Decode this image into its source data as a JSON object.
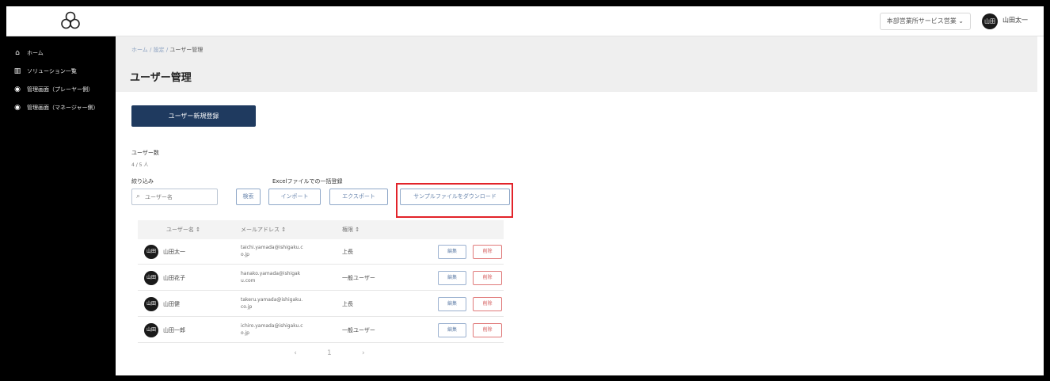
{
  "header": {
    "tenant_select": "本部営業所サービス営業 ⌄",
    "user_initials": "山田",
    "user_name": "山田太一"
  },
  "sidebar": {
    "items": [
      {
        "icon": "home-icon",
        "glyph": "⌂",
        "label": "ホーム"
      },
      {
        "icon": "chart-icon",
        "glyph": "▥",
        "label": "ソリューション一覧"
      },
      {
        "icon": "settings-circle-icon",
        "glyph": "◉",
        "label": "管理画面（プレーヤー側）"
      },
      {
        "icon": "settings-circle-icon",
        "glyph": "◉",
        "label": "管理画面（マネージャー側）"
      }
    ]
  },
  "main": {
    "breadcrumb_parent": "ホーム / 設定 /",
    "breadcrumb_current": "ユーザー管理",
    "title": "ユーザー管理",
    "new_user_button": "ユーザー新規登録",
    "user_count_label": "ユーザー数",
    "user_count_value": "4 / 5 人",
    "filter_label": "絞り込み",
    "search_placeholder": "ユーザー名",
    "search_button": "検索",
    "excel_label": "Excelファイルでの一括登録",
    "import_button": "インポート",
    "export_button": "エクスポート",
    "sample_download_button": "サンプルファイルをダウンロード"
  },
  "table": {
    "headers": [
      "ユーザー名 ↕",
      "メールアドレス ↕",
      "権限 ↕"
    ],
    "edit_label": "編集",
    "delete_label": "削除",
    "rows": [
      {
        "initials": "山田",
        "name": "山田太一",
        "email": "taichi.yamada@ishigaku.co.jp",
        "role": "上長"
      },
      {
        "initials": "山田",
        "name": "山田花子",
        "email": "hanako.yamada@ishigaku.com",
        "role": "一般ユーザー"
      },
      {
        "initials": "山田",
        "name": "山田健",
        "email": "takeru.yamada@ishigaku.co.jp",
        "role": "上長"
      },
      {
        "initials": "山田",
        "name": "山田一郎",
        "email": "ichiro.yamada@ishigaku.co.jp",
        "role": "一般ユーザー"
      }
    ]
  },
  "pagination": {
    "prev": "‹",
    "page": "1",
    "next": "›"
  }
}
